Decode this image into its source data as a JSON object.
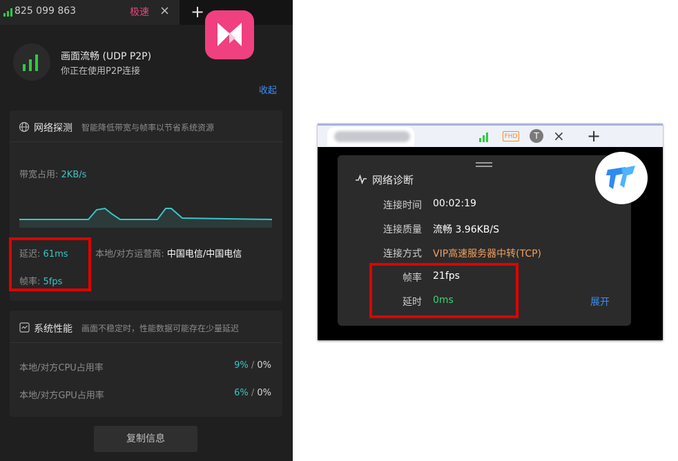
{
  "left": {
    "tab": {
      "phone": "825 099 863",
      "speed_label": "极速",
      "close": "×",
      "add": "+"
    },
    "connection": {
      "title": "画面流畅 (UDP P2P)",
      "subtitle": "你正在使用P2P连接",
      "collapse": "收起"
    },
    "network": {
      "title": "网络探测",
      "desc": "智能降低带宽与帧率以节省系统资源",
      "bandwidth_label": "带宽占用:",
      "bandwidth_value": "2KB/s",
      "latency_label": "延迟:",
      "latency_value": "61ms",
      "operator_label": "本地/对方运营商:",
      "operator_value": "中国电信/中国电信",
      "fps_label": "帧率:",
      "fps_value": "5fps"
    },
    "perf": {
      "title": "系统性能",
      "desc": "画面不稳定时，性能数据可能存在少量延迟",
      "cpu_label": "本地/对方CPU占用率",
      "cpu_local": "9%",
      "cpu_sep": " / ",
      "cpu_remote": "0%",
      "gpu_label": "本地/对方GPU占用率",
      "gpu_local": "6%",
      "gpu_sep": " / ",
      "gpu_remote": "0%"
    },
    "copy_button": "复制信息"
  },
  "right": {
    "tab": {
      "fhd": "FHD",
      "avatar": "T",
      "close": "×",
      "add": "+"
    },
    "diag": {
      "title": "网络诊断",
      "rows": [
        {
          "label": "连接时间",
          "value": "00:02:19"
        },
        {
          "label": "连接质量",
          "value": "流畅 3.96KB/S"
        },
        {
          "label": "连接方式",
          "value": "VIP高速服务器中转(TCP)"
        },
        {
          "label": "帧率",
          "value": "21fps"
        },
        {
          "label": "延时",
          "value": "0ms"
        }
      ],
      "expand": "展开"
    }
  },
  "colors": {
    "accent_cyan": "#39c6c6",
    "signal_green": "#2ecc40",
    "highlight_red": "#e00000",
    "link_blue": "#3a8ef6",
    "orange": "#f0a060",
    "green_value": "#3bd16f"
  }
}
